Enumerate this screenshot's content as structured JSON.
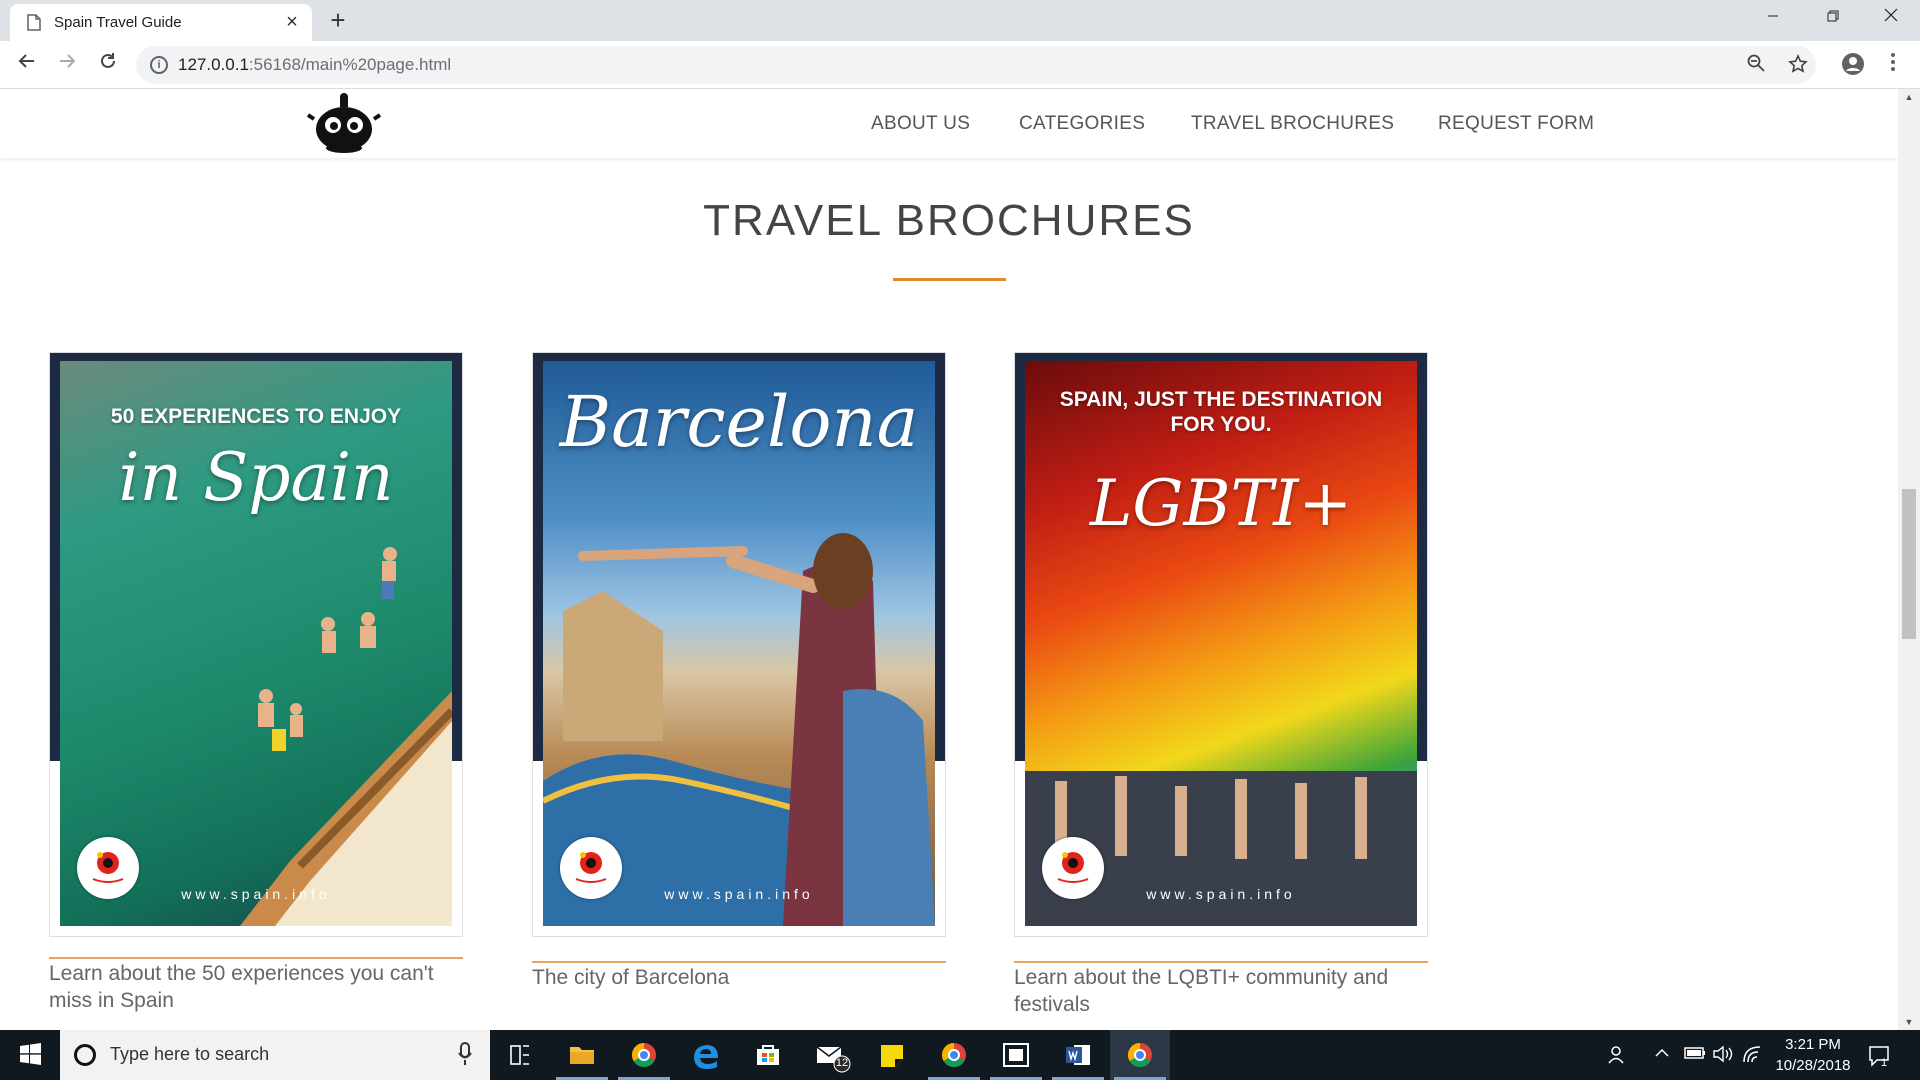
{
  "browser": {
    "tab_title": "Spain Travel Guide",
    "url_host": "127.0.0.1",
    "url_path": ":56168/main%20page.html"
  },
  "site": {
    "nav": [
      "ABOUT US",
      "CATEGORIES",
      "TRAVEL BROCHURES",
      "REQUEST FORM"
    ],
    "section_title": "TRAVEL BROCHURES",
    "accent_color": "#e08a2c"
  },
  "brochures": [
    {
      "headline": "50 EXPERIENCES TO ENJOY",
      "script": "in Spain",
      "url": "www.spain.info",
      "badge": "España",
      "caption": "Learn about the 50 experiences you can't miss in Spain"
    },
    {
      "headline": "",
      "script": "Barcelona",
      "url": "www.spain.info",
      "badge": "España",
      "caption": "The city of Barcelona"
    },
    {
      "headline": "SPAIN, JUST THE DESTINATION FOR YOU.",
      "script": "LGBTI+",
      "url": "www.spain.info",
      "badge": "España",
      "caption": "Learn about the LQBTI+ community and festivals"
    }
  ],
  "taskbar": {
    "search_placeholder": "Type here to search",
    "mail_badge": "12",
    "time": "3:21 PM",
    "date": "10/28/2018",
    "notification_count": "1"
  }
}
